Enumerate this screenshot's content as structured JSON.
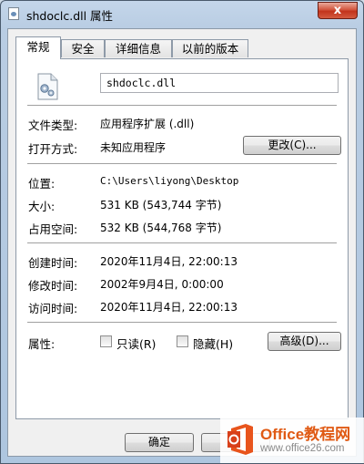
{
  "window": {
    "title": "shdoclc.dll 属性",
    "close_label": "x"
  },
  "tabs": [
    {
      "label": "常规",
      "active": true
    },
    {
      "label": "安全",
      "active": false
    },
    {
      "label": "详细信息",
      "active": false
    },
    {
      "label": "以前的版本",
      "active": false
    }
  ],
  "general": {
    "file_name": "shdoclc.dll",
    "file_type_label": "文件类型:",
    "file_type_value": "应用程序扩展 (.dll)",
    "opens_with_label": "打开方式:",
    "opens_with_value": "未知应用程序",
    "change_button": "更改(C)...",
    "location_label": "位置:",
    "location_value": "C:\\Users\\liyong\\Desktop",
    "size_label": "大小:",
    "size_value": "531 KB (543,744 字节)",
    "disk_size_label": "占用空间:",
    "disk_size_value": "532 KB (544,768 字节)",
    "created_label": "创建时间:",
    "created_value": "2020年11月4日, 22:00:13",
    "modified_label": "修改时间:",
    "modified_value": "2002年9月4日, 0:00:00",
    "accessed_label": "访问时间:",
    "accessed_value": "2020年11月4日, 22:00:13",
    "attributes_label": "属性:",
    "readonly_label": "只读(R)",
    "readonly_checked": false,
    "hidden_label": "隐藏(H)",
    "hidden_checked": false,
    "advanced_button": "高级(D)..."
  },
  "footer": {
    "ok_button": "确定"
  },
  "watermark": {
    "title": "Office教程网",
    "url": "www.office26.com"
  },
  "colors": {
    "title_bar": "#b9cde3",
    "close_button": "#c2331b",
    "watermark_orange": "#e05a14"
  }
}
